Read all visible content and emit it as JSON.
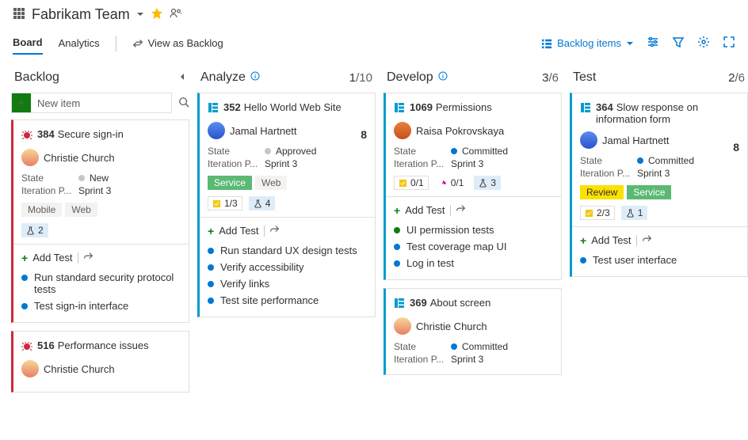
{
  "header": {
    "team": "Fabrikam Team"
  },
  "tabs": {
    "board": "Board",
    "analytics": "Analytics",
    "viewAs": "View as Backlog",
    "backlogItems": "Backlog items"
  },
  "columns": {
    "backlog": {
      "title": "Backlog",
      "newItem": "New item"
    },
    "analyze": {
      "title": "Analyze",
      "count": "1",
      "limit": "/10"
    },
    "develop": {
      "title": "Develop",
      "count": "3",
      "limit": "/6"
    },
    "test": {
      "title": "Test",
      "count": "2",
      "limit": "/6"
    }
  },
  "labels": {
    "state": "State",
    "iteration": "Iteration P...",
    "addTest": "Add Test"
  },
  "cards": {
    "c384": {
      "id": "384",
      "title": "Secure sign-in",
      "assignee": "Christie Church",
      "state": "New",
      "iteration": "Sprint 3",
      "tags": [
        "Mobile",
        "Web"
      ],
      "flask": "2",
      "tests": [
        "Run standard security protocol tests",
        "Test sign-in interface"
      ]
    },
    "c516": {
      "id": "516",
      "title": "Performance issues",
      "assignee": "Christie Church"
    },
    "c352": {
      "id": "352",
      "title": "Hello World Web Site",
      "assignee": "Jamal Hartnett",
      "effort": "8",
      "state": "Approved",
      "iteration": "Sprint 3",
      "tags": [
        "Service",
        "Web"
      ],
      "chip1": "1/3",
      "chip2": "4",
      "tests": [
        "Run standard UX design tests",
        "Verify accessibility",
        "Verify links",
        "Test site performance"
      ]
    },
    "c1069": {
      "id": "1069",
      "title": "Permissions",
      "assignee": "Raisa Pokrovskaya",
      "state": "Committed",
      "iteration": "Sprint 3",
      "chip1": "0/1",
      "chip2": "0/1",
      "chip3": "3",
      "tests": [
        "UI permission tests",
        "Test coverage map UI",
        "Log in test"
      ]
    },
    "c369": {
      "id": "369",
      "title": "About screen",
      "assignee": "Christie Church",
      "state": "Committed",
      "iteration": "Sprint 3"
    },
    "c364": {
      "id": "364",
      "title": "Slow response on information form",
      "assignee": "Jamal Hartnett",
      "effort": "8",
      "state": "Committed",
      "iteration": "Sprint 3",
      "tags": [
        "Review",
        "Service"
      ],
      "chip1": "2/3",
      "chip2": "1",
      "tests": [
        "Test user interface"
      ]
    }
  }
}
